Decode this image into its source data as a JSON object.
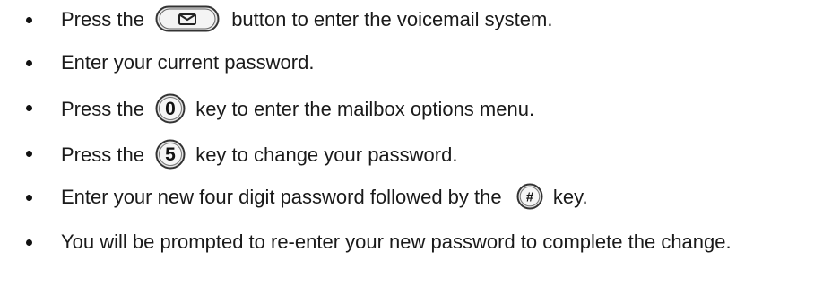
{
  "steps": [
    {
      "before": "Press the",
      "icon": "envelope-icon",
      "after": "button to enter the voicemail system."
    },
    {
      "text": "Enter your current password."
    },
    {
      "before": "Press the",
      "icon": "key-0",
      "key_label": "0",
      "after": "key to enter the mailbox options menu."
    },
    {
      "before": "Press the",
      "icon": "key-5",
      "key_label": "5",
      "after": "key to change your password."
    },
    {
      "before": "Enter your new four digit password followed by the",
      "icon": "key-hash",
      "key_label": "#",
      "after": "key."
    },
    {
      "text": "You will be prompted to re-enter your new password to complete the change."
    }
  ]
}
